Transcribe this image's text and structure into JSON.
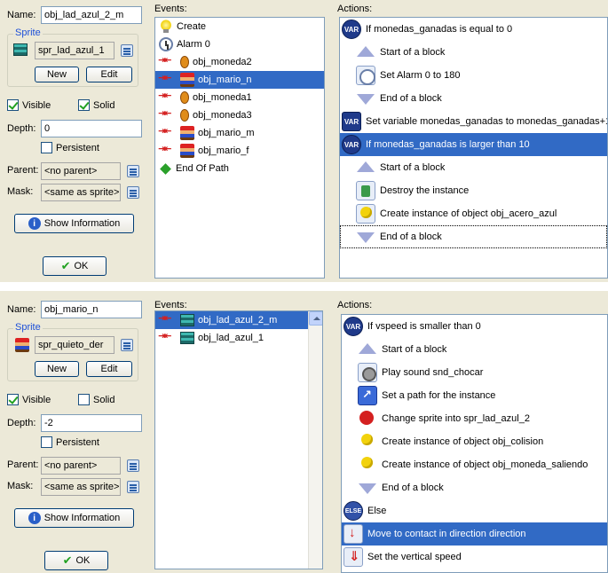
{
  "windows": [
    {
      "name_label": "Name:",
      "name_value": "obj_lad_azul_2_m",
      "sprite_group": "Sprite",
      "sprite_value": "spr_lad_azul_1",
      "new_label": "New",
      "edit_label": "Edit",
      "visible_label": "Visible",
      "visible_checked": true,
      "solid_label": "Solid",
      "solid_checked": true,
      "depth_label": "Depth:",
      "depth_value": "0",
      "persistent_label": "Persistent",
      "parent_label": "Parent:",
      "parent_value": "<no parent>",
      "mask_label": "Mask:",
      "mask_value": "<same as sprite>",
      "show_info_label": "Show Information",
      "ok_label": "OK",
      "events_title": "Events:",
      "events": [
        {
          "icon": "bulb-icon",
          "label": "Create",
          "selected": false
        },
        {
          "icon": "clock-icon",
          "label": "Alarm 0",
          "selected": false
        },
        {
          "icon": "collision-icon",
          "label": "obj_moneda2",
          "selected": false
        },
        {
          "icon": "collision-icon",
          "label": "obj_mario_n",
          "selected": true
        },
        {
          "icon": "collision-icon",
          "label": "obj_moneda1",
          "selected": false
        },
        {
          "icon": "collision-icon",
          "label": "obj_moneda3",
          "selected": false
        },
        {
          "icon": "collision-icon",
          "label": "obj_mario_m",
          "selected": false
        },
        {
          "icon": "collision-icon",
          "label": "obj_mario_f",
          "selected": false
        },
        {
          "icon": "diamond-icon",
          "label": "End Of Path",
          "selected": false
        }
      ],
      "actions_title": "Actions:",
      "actions": [
        {
          "icon": "var-icon",
          "label": "If monedas_ganadas is equal to 0",
          "indent": 0,
          "selected": false
        },
        {
          "icon": "start-block-icon",
          "label": "Start of a block",
          "indent": 1,
          "selected": false
        },
        {
          "icon": "alarm-icon",
          "label": "Set Alarm 0 to 180",
          "indent": 1,
          "selected": false
        },
        {
          "icon": "end-block-icon",
          "label": "End of a block",
          "indent": 1,
          "selected": false
        },
        {
          "icon": "set-var-icon",
          "label": "Set variable monedas_ganadas to monedas_ganadas+1",
          "indent": 0,
          "selected": false
        },
        {
          "icon": "var-icon",
          "label": "If monedas_ganadas is larger than 10",
          "indent": 0,
          "selected": true
        },
        {
          "icon": "start-block-icon",
          "label": "Start of a block",
          "indent": 1,
          "selected": false
        },
        {
          "icon": "destroy-icon",
          "label": "Destroy the instance",
          "indent": 1,
          "selected": false
        },
        {
          "icon": "create-instance-icon",
          "label": "Create instance of object obj_acero_azul",
          "indent": 1,
          "selected": false
        },
        {
          "icon": "end-block-icon",
          "label": "End of a block",
          "indent": 1,
          "selected": false,
          "focused": true
        }
      ]
    },
    {
      "name_label": "Name:",
      "name_value": "obj_mario_n",
      "sprite_group": "Sprite",
      "sprite_value": "spr_quieto_der",
      "new_label": "New",
      "edit_label": "Edit",
      "visible_label": "Visible",
      "visible_checked": true,
      "solid_label": "Solid",
      "solid_checked": false,
      "depth_label": "Depth:",
      "depth_value": "-2",
      "persistent_label": "Persistent",
      "parent_label": "Parent:",
      "parent_value": "<no parent>",
      "mask_label": "Mask:",
      "mask_value": "<same as sprite>",
      "show_info_label": "Show Information",
      "ok_label": "OK",
      "events_title": "Events:",
      "events": [
        {
          "icon": "collision-icon",
          "label": "obj_lad_azul_2_m",
          "selected": true
        },
        {
          "icon": "collision-icon",
          "label": "obj_lad_azul_1",
          "selected": false
        }
      ],
      "actions_title": "Actions:",
      "actions": [
        {
          "icon": "var-icon",
          "label": "If vspeed is smaller than 0",
          "indent": 0,
          "selected": false
        },
        {
          "icon": "start-block-icon",
          "label": "Start of a block",
          "indent": 1,
          "selected": false
        },
        {
          "icon": "sound-icon",
          "label": "Play sound snd_chocar",
          "indent": 1,
          "selected": false
        },
        {
          "icon": "path-icon",
          "label": "Set a path for the instance",
          "indent": 1,
          "selected": false
        },
        {
          "icon": "change-sprite-icon",
          "label": "Change sprite into spr_lad_azul_2",
          "indent": 1,
          "selected": false
        },
        {
          "icon": "create-instance-icon",
          "label": "Create instance of object obj_colision",
          "indent": 1,
          "selected": false
        },
        {
          "icon": "create-instance-icon",
          "label": "Create instance of object obj_moneda_saliendo",
          "indent": 1,
          "selected": false
        },
        {
          "icon": "end-block-icon",
          "label": "End of a block",
          "indent": 1,
          "selected": false
        },
        {
          "icon": "else-icon",
          "label": "Else",
          "indent": 0,
          "selected": false
        },
        {
          "icon": "move-contact-icon",
          "label": "Move to contact in direction direction",
          "indent": 0,
          "selected": true
        },
        {
          "icon": "vspeed-icon",
          "label": "Set the vertical speed",
          "indent": 0,
          "selected": false
        }
      ]
    }
  ]
}
